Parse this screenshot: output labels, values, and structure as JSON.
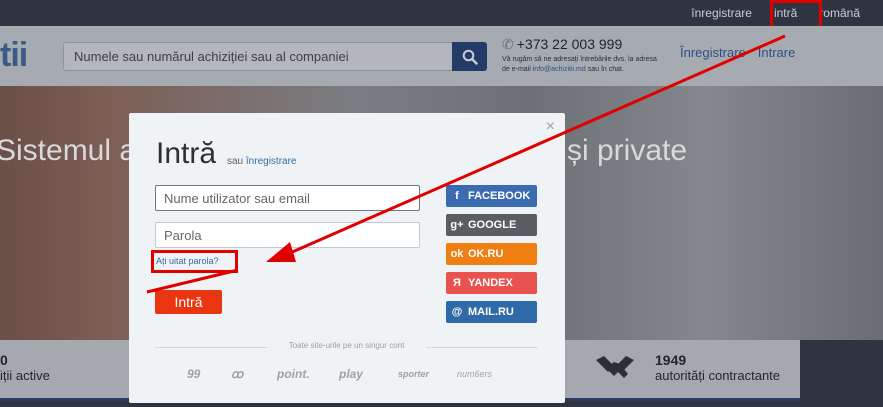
{
  "topnav": {
    "register": "înregistrare",
    "login": "intră",
    "language": "română"
  },
  "header": {
    "logo_fragment": "tii",
    "search_placeholder": "Numele sau numărul achiziției sau al companiei",
    "phone": "+373 22 003 999",
    "phone_note_1": "Vă rugăm să ne adresați întrebările dvs. la adresa",
    "phone_note_2a": "de e-mail",
    "phone_email": "info@achizitii.md",
    "phone_note_2b": "sau în chat.",
    "link_register": "Înregistrare",
    "link_login": "Intrare"
  },
  "hero": {
    "text_left": "Sistemul a",
    "text_right": "și private"
  },
  "stats": {
    "left_number": "0",
    "left_label": "iții active",
    "right_number": "1949",
    "right_label": "autorități contractante"
  },
  "modal": {
    "close": "×",
    "title": "Intră",
    "sub_prefix": "sau",
    "sub_link": "înregistrare",
    "username_placeholder": "Nume utilizator sau email",
    "password_placeholder": "Parola",
    "forgot": "Ați uitat parola?",
    "submit": "Intră",
    "divider": "Toate site-urile pe un singur cont",
    "social": [
      {
        "icon": "f",
        "label": "FACEBOOK",
        "color": "#3b6bb0"
      },
      {
        "icon": "g+",
        "label": "GOOGLE",
        "color": "#5a5e63"
      },
      {
        "icon": "ok",
        "label": "OK.RU",
        "color": "#f07f12"
      },
      {
        "icon": "Я",
        "label": "YANDEX",
        "color": "#e8524f"
      },
      {
        "icon": "@",
        "label": "MAIL.RU",
        "color": "#2f6aa8"
      }
    ],
    "partners": [
      "99",
      "ꝏ",
      "point.",
      "play",
      "sporter",
      "num6ers"
    ]
  },
  "colors": {
    "accent_red": "#e00000",
    "login_button": "#ea3511",
    "link_blue": "#2f6ea6"
  }
}
